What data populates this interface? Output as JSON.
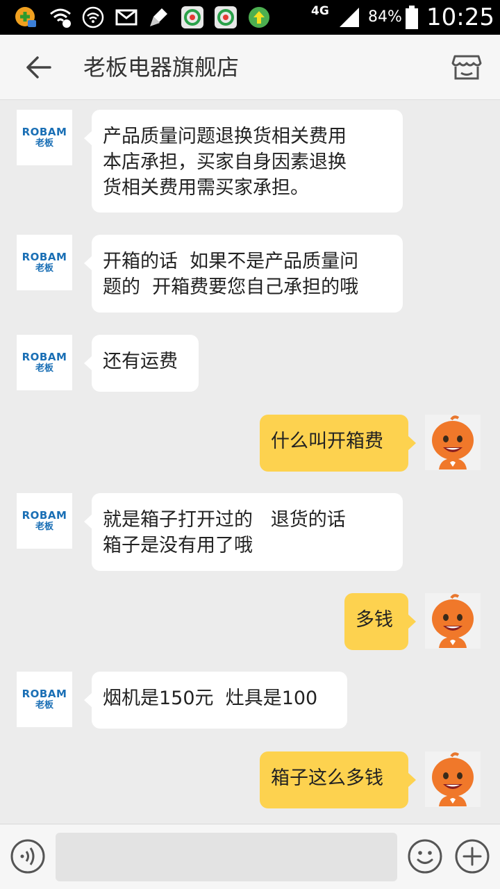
{
  "status_bar": {
    "network": "4G",
    "battery": "84%",
    "time": "10:25"
  },
  "header": {
    "title": "老板电器旗舰店",
    "back_icon": "arrow-left-icon",
    "shop_icon": "shop-icon"
  },
  "shop_avatar": {
    "brand": "ROBAM",
    "brand_cn": "老板"
  },
  "messages": [
    {
      "side": "left",
      "text": "产品质量问题退换货相关费用\n本店承担，买家自身因素退换\n货相关费用需买家承担。"
    },
    {
      "side": "left",
      "text": "开箱的话  如果不是产品质量问\n题的  开箱费要您自己承担的哦"
    },
    {
      "side": "left",
      "text": "还有运费"
    },
    {
      "side": "right",
      "text": "什么叫开箱费"
    },
    {
      "side": "left",
      "text": "就是箱子打开过的   退货的话\n箱子是没有用了哦"
    },
    {
      "side": "right",
      "text": "多钱"
    },
    {
      "side": "left",
      "text": "烟机是150元  灶具是100"
    },
    {
      "side": "right",
      "text": "箱子这么多钱"
    }
  ],
  "bottom_bar": {
    "input_value": "",
    "input_placeholder": "",
    "voice_icon": "voice-icon",
    "emoji_icon": "emoji-icon",
    "plus_icon": "plus-icon"
  },
  "colors": {
    "accent_bubble": "#fdd24f",
    "brand_blue": "#1a6fb5",
    "background": "#ececec"
  }
}
